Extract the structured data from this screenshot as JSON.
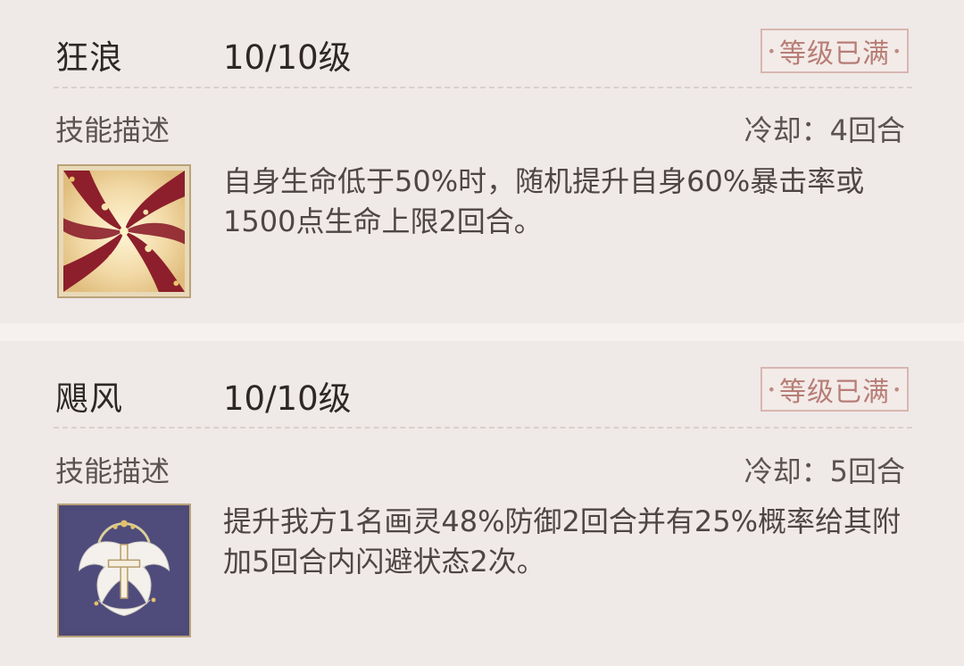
{
  "skills": [
    {
      "name": "狂浪",
      "level": "10/10级",
      "badge": "等级已满",
      "desc_label": "技能描述",
      "cooldown": "冷却：4回合",
      "description": "自身生命低于50%时，随机提升自身60%暴击率或1500点生命上限2回合。",
      "icon": "whirlpool-icon"
    },
    {
      "name": "飓风",
      "level": "10/10级",
      "badge": "等级已满",
      "desc_label": "技能描述",
      "cooldown": "冷却：5回合",
      "description": "提升我方1名画灵48%防御2回合并有25%概率给其附加5回合内闪避状态2次。",
      "icon": "winged-cross-icon"
    }
  ],
  "colors": {
    "badge_text": "#b77d76",
    "card_bg": "#efe9e7",
    "icon_border": "#b9a279"
  }
}
